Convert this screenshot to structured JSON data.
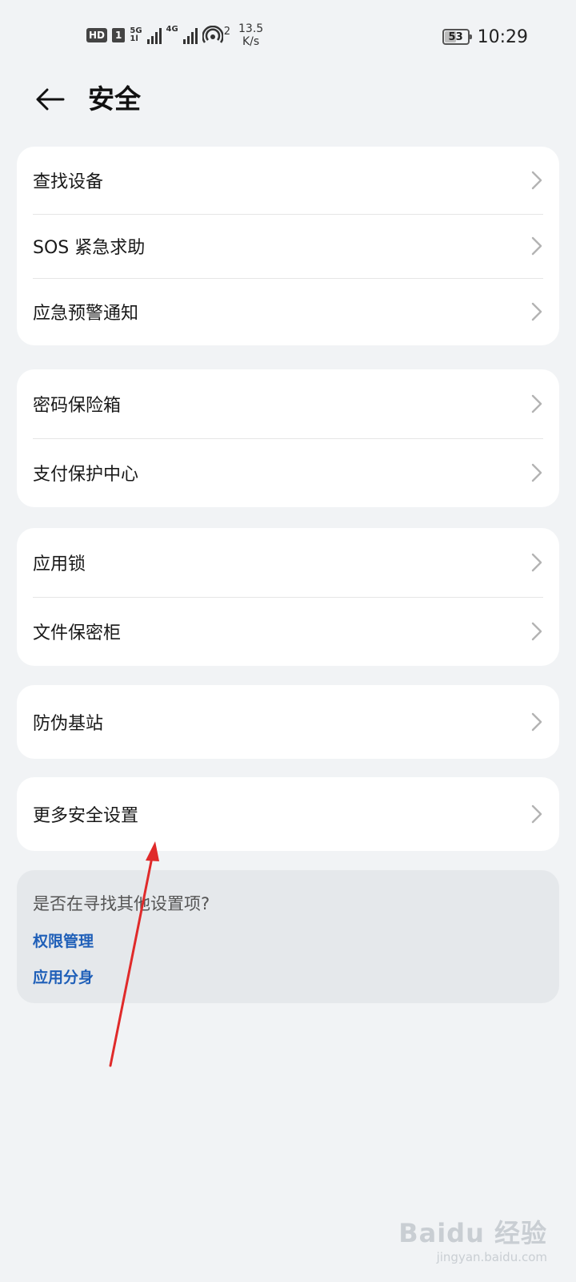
{
  "status_bar": {
    "hd": "HD",
    "sim": "1",
    "net1_top": "5G",
    "net1_bottom": "1l",
    "net2": "4G",
    "hotspot_count": "2",
    "speed_value": "13.5",
    "speed_unit": "K/s",
    "battery": "53",
    "battery_level": 0.53,
    "time": "10:29"
  },
  "header": {
    "title": "安全"
  },
  "groups": [
    {
      "items": [
        {
          "label": "查找设备"
        },
        {
          "label": "SOS 紧急求助"
        },
        {
          "label": "应急预警通知"
        }
      ]
    },
    {
      "items": [
        {
          "label": "密码保险箱"
        },
        {
          "label": "支付保护中心"
        }
      ]
    },
    {
      "items": [
        {
          "label": "应用锁"
        },
        {
          "label": "文件保密柜"
        }
      ]
    },
    {
      "items": [
        {
          "label": "防伪基站"
        }
      ]
    },
    {
      "items": [
        {
          "label": "更多安全设置"
        }
      ]
    }
  ],
  "suggestions": {
    "title": "是否在寻找其他设置项?",
    "links": [
      {
        "label": "权限管理"
      },
      {
        "label": "应用分身"
      }
    ]
  },
  "watermark": {
    "main": "Baidu 经验",
    "sub": "jingyan.baidu.com"
  },
  "colors": {
    "background": "#f1f3f5",
    "card": "#ffffff",
    "link": "#1f5fb8",
    "annotation": "#e02a2a"
  }
}
